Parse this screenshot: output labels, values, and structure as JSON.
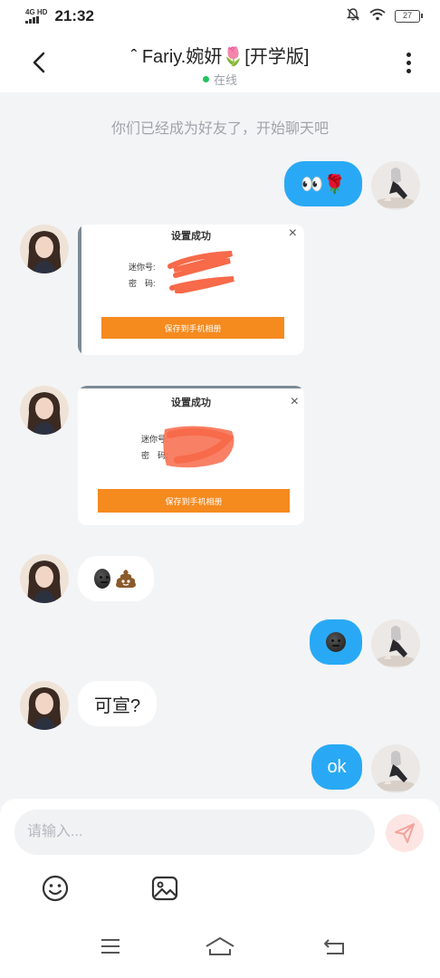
{
  "status_bar": {
    "network": "4G HD",
    "time": "21:32",
    "battery": "27",
    "icons": [
      "mute-bell-icon",
      "wifi-icon",
      "battery-icon"
    ]
  },
  "header": {
    "title": "ˆ Fariy.婉妍🌷[开学版]",
    "presence": "在线",
    "presence_color": "#21c35b",
    "icons": [
      "back-arrow-icon",
      "more-vertical-icon"
    ]
  },
  "chat": {
    "system_message": "你们已经成为好友了，开始聊天吧",
    "messages": [
      {
        "from": "me",
        "type": "text",
        "text": "👀🌹"
      },
      {
        "from": "contact",
        "type": "image",
        "dialog": {
          "title": "设置成功",
          "labels": [
            "迷你号:",
            "密　码:"
          ],
          "button": "保存到手机相册",
          "close": "×"
        }
      },
      {
        "from": "contact",
        "type": "image",
        "dialog": {
          "title": "设置成功",
          "labels": [
            "迷你号:",
            "密　码:"
          ],
          "button": "保存到手机相册",
          "close": "×"
        }
      },
      {
        "from": "contact",
        "type": "emoji",
        "emojis": [
          "dark-face-emoji",
          "poop-emoji"
        ]
      },
      {
        "from": "me",
        "type": "emoji",
        "emojis": [
          "dark-face-emoji"
        ]
      },
      {
        "from": "contact",
        "type": "text",
        "text": "可宣?"
      },
      {
        "from": "me",
        "type": "text",
        "text": "ok"
      }
    ]
  },
  "composer": {
    "placeholder": "请输入...",
    "icons": [
      "send-icon",
      "emoji-icon",
      "image-icon"
    ]
  },
  "nav_bar": {
    "icons": [
      "menu-icon",
      "home-icon",
      "back-icon"
    ]
  },
  "colors": {
    "accent": "#29a9f5",
    "background": "#f3f4f6",
    "save_button": "#f58a1f",
    "redaction": "#f76a4a"
  }
}
